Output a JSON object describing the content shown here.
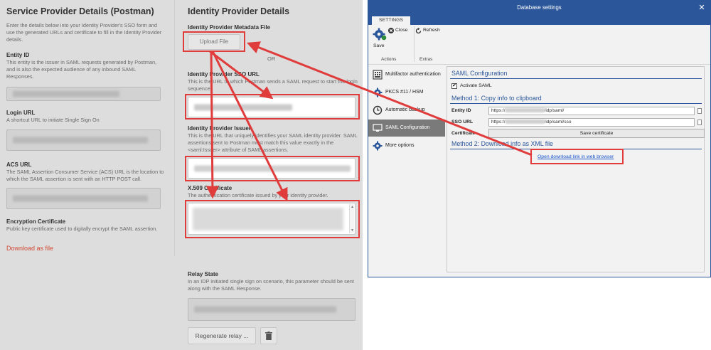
{
  "postman": {
    "sp": {
      "title": "Service Provider Details (Postman)",
      "intro": "Enter the details below into your Identity Provider's SSO form and use the generated URLs and certificate to fill in the Identity Provider details.",
      "entity_id": {
        "label": "Entity ID",
        "desc": "This entity is the issuer in SAML requests generated by Postman, and is also the expected audience of any inbound SAML Responses."
      },
      "login_url": {
        "label": "Login URL",
        "desc": "A shortcut URL to initiate Single Sign On"
      },
      "acs_url": {
        "label": "ACS URL",
        "desc": "The SAML Assertion Consumer Service (ACS) URL is the location to which the SAML assertion is sent with an HTTP POST call."
      },
      "enc_cert": {
        "label": "Encryption Certificate",
        "desc": "Public key certificate used to digitally encrypt the SAML assertion."
      },
      "download_label": "Download as file"
    },
    "idp": {
      "title": "Identity Provider Details",
      "metadata_label": "Identity Provider Metadata File",
      "upload_label": "Upload File",
      "or_label": "OR",
      "sso_url": {
        "label": "Identity Provider SSO URL",
        "desc": "This is the URL to which Postman sends a SAML request to start the login sequence."
      },
      "issuer": {
        "label": "Identity Provider Issuer",
        "desc": "This is the URL that uniquely identifies your SAML identity provider. SAML assertions sent to Postman must match this value exactly in the <saml:Issuer> attribute of SAML assertions."
      },
      "x509": {
        "label": "X.509 Certificate",
        "desc": "The authentication certificate issued by your identity provider."
      },
      "relay": {
        "label": "Relay State",
        "desc": "In an IDP initiated single sign on scenario, this parameter should be sent along with the SAML Response."
      },
      "regenerate_label": "Regenerate relay ...",
      "trash_icon": "trash-icon"
    }
  },
  "dbsettings": {
    "window_title": "Database settings",
    "close_glyph": "✕",
    "tab_label": "SETTINGS",
    "ribbon": {
      "save_label": "Save",
      "close_label": "Close",
      "refresh_label": "Refresh",
      "group_actions": "Actions",
      "group_extras": "Extras"
    },
    "nav": [
      {
        "label": "Multifactor authentication",
        "icon": "grid-icon"
      },
      {
        "label": "PKCS #11 / HSM",
        "icon": "gear-icon"
      },
      {
        "label": "Automatic backup",
        "icon": "clock-icon"
      },
      {
        "label": "SAML Configuration",
        "icon": "monitor-icon"
      },
      {
        "label": "More options",
        "icon": "gear-icon"
      }
    ],
    "saml": {
      "section_title": "SAML Configuration",
      "activate_label": "Activate SAML",
      "activate_checked": true,
      "check_glyph": "✔",
      "method1": "Method 1: Copy info to clipboard",
      "entity_id_label": "Entity ID",
      "entity_id_prefix": "https://",
      "entity_id_suffix": "/idp/saml/",
      "sso_url_label": "SSO URL",
      "sso_url_prefix": "https://",
      "sso_url_suffix": "/idp/saml/sso",
      "certificate_label": "Certificate",
      "save_cert_label": "Save certificate",
      "method2": "Method 2: Download info as XML file",
      "open_link_label": "Open download link in web browser"
    }
  },
  "colors": {
    "accent": "#2b579a",
    "highlight": "#e03c3c",
    "download_link": "#d24a35"
  }
}
